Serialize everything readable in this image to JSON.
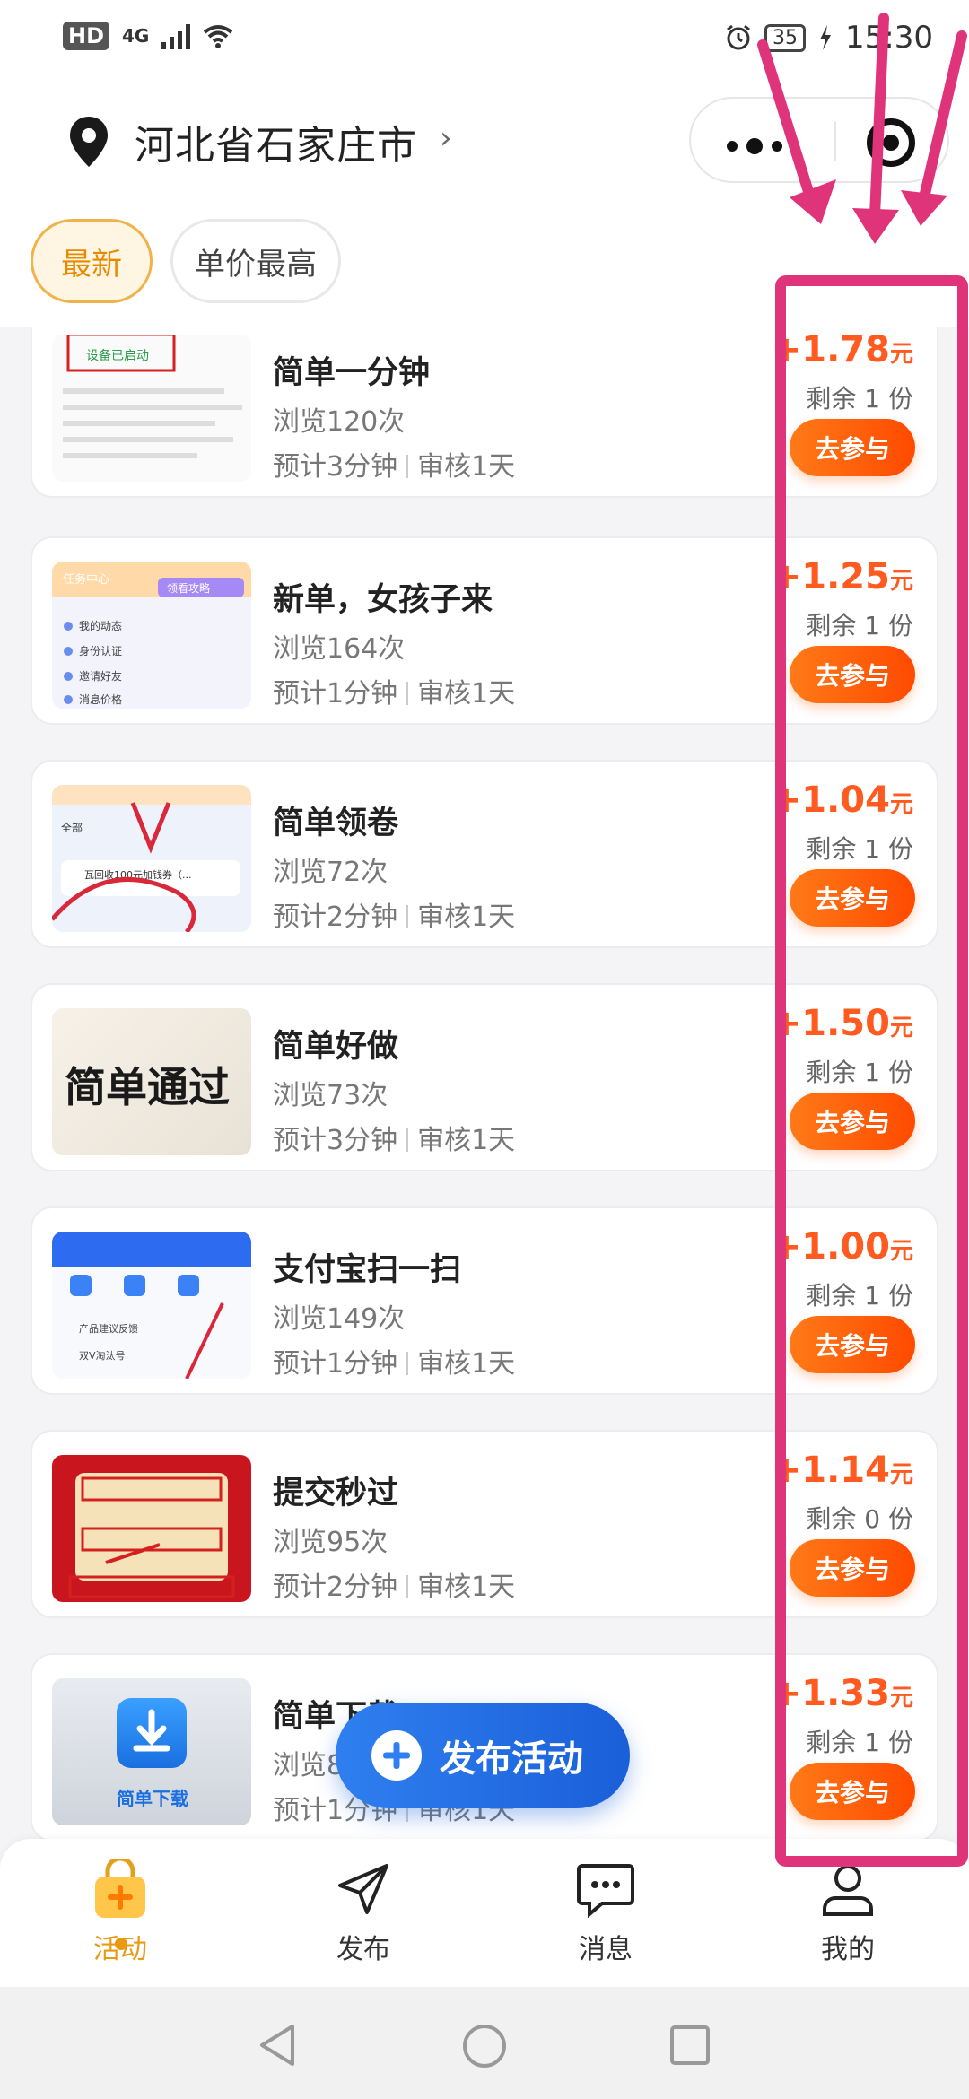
{
  "status_bar": {
    "hd": "HD",
    "network": "4G",
    "battery": "35",
    "time": "15:30"
  },
  "header": {
    "location": "河北省石家庄市"
  },
  "filters": {
    "active_label": "最新",
    "second_label": "单价最高"
  },
  "tasks": [
    {
      "title": "简单一分钟",
      "views": "浏览120次",
      "duration": "预计3分钟",
      "review": "审核1天",
      "price": "+1.78",
      "unit": "元",
      "remaining": "剩余 1 份",
      "button": "去参与"
    },
    {
      "title": "新单，女孩子来",
      "views": "浏览164次",
      "duration": "预计1分钟",
      "review": "审核1天",
      "price": "+1.25",
      "unit": "元",
      "remaining": "剩余 1 份",
      "button": "去参与"
    },
    {
      "title": "简单领卷",
      "views": "浏览72次",
      "duration": "预计2分钟",
      "review": "审核1天",
      "price": "+1.04",
      "unit": "元",
      "remaining": "剩余 1 份",
      "button": "去参与"
    },
    {
      "title": "简单好做",
      "views": "浏览73次",
      "duration": "预计3分钟",
      "review": "审核1天",
      "price": "+1.50",
      "unit": "元",
      "remaining": "剩余 1 份",
      "button": "去参与"
    },
    {
      "title": "支付宝扫一扫",
      "views": "浏览149次",
      "duration": "预计1分钟",
      "review": "审核1天",
      "price": "+1.00",
      "unit": "元",
      "remaining": "剩余 1 份",
      "button": "去参与"
    },
    {
      "title": "提交秒过",
      "views": "浏览95次",
      "duration": "预计2分钟",
      "review": "审核1天",
      "price": "+1.14",
      "unit": "元",
      "remaining": "剩余 0 份",
      "button": "去参与"
    },
    {
      "title": "简单下载",
      "views": "浏览8",
      "duration": "预计1分钟",
      "review": "审核1天",
      "price": "+1.33",
      "unit": "元",
      "remaining": "剩余 1 份",
      "button": "去参与"
    }
  ],
  "thumbs": {
    "t1_text": "设备已启动",
    "t2_title": "任务中心",
    "t2_btn": "领看攻略",
    "t2_items": [
      "我的动态",
      "身份认证",
      "邀请好友",
      "消息价格"
    ],
    "t3_tab": "全部",
    "t3_text": "瓦回收100元加钱券（...",
    "t4_text": "简单通过",
    "t5_items": [
      "产品建议反馈",
      "双V淘汰号"
    ],
    "t7_text": "简单下载"
  },
  "fab": {
    "label": "发布活动"
  },
  "tabbar": {
    "items": [
      {
        "label": "活动",
        "icon": "shopping-bag-icon"
      },
      {
        "label": "发布",
        "icon": "paper-plane-icon"
      },
      {
        "label": "消息",
        "icon": "chat-bubble-icon"
      },
      {
        "label": "我的",
        "icon": "user-icon"
      }
    ]
  },
  "colors": {
    "accent": "#e89a12",
    "price": "#ff5a1f",
    "annotation": "#e0347a",
    "fab": "#2f7ff0"
  }
}
